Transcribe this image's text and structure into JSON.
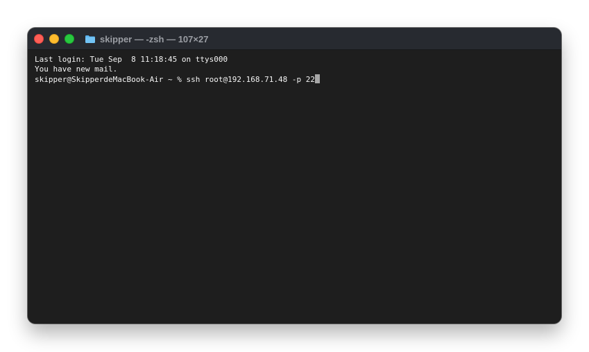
{
  "window": {
    "title": "skipper — -zsh — 107×27"
  },
  "terminal": {
    "lines": [
      "Last login: Tue Sep  8 11:18:45 on ttys000",
      "You have new mail.",
      "skipper@SkipperdeMacBook-Air ~ % ssh root@192.168.71.48 -p 22"
    ]
  },
  "colors": {
    "background": "#1e1e1e",
    "titlebar": "#272a30",
    "text": "#f4f4f4",
    "cursor": "#a7a7a7",
    "close": "#fe5f57",
    "minimize": "#febc2e",
    "zoom": "#28c840"
  },
  "icons": {
    "title": "folder-icon",
    "controls": [
      "close-icon",
      "minimize-icon",
      "zoom-icon"
    ]
  }
}
